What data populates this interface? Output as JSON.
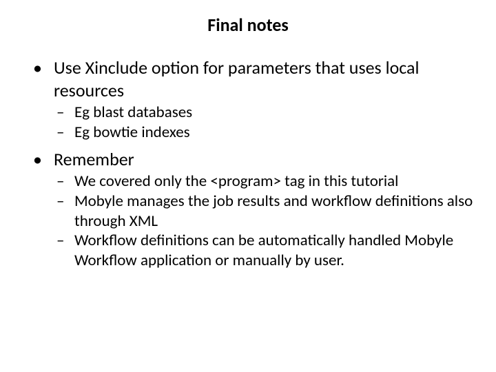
{
  "title": "Final notes",
  "items": [
    {
      "text": "Use Xinclude option for parameters that uses local resources",
      "sub": [
        "Eg blast databases",
        "Eg bowtie indexes"
      ]
    },
    {
      "text": "Remember",
      "sub": [
        "We covered only the <program> tag in this tutorial",
        "Mobyle manages the job results and workflow definitions also through XML",
        "Workflow definitions can be automatically handled Mobyle Workflow application or manually by user."
      ]
    }
  ]
}
